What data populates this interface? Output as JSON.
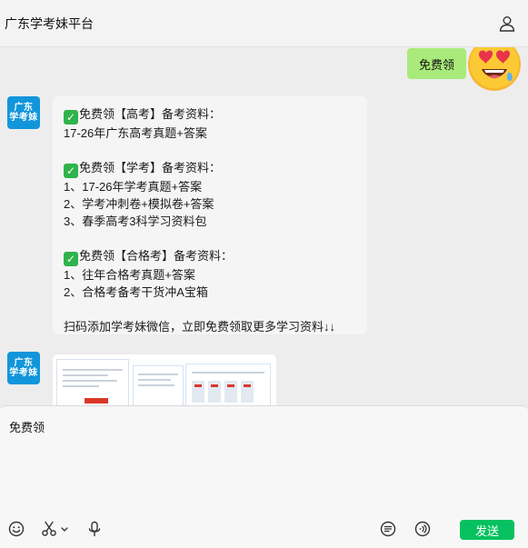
{
  "header": {
    "title": "广东学考妹平台"
  },
  "icons": {
    "profile": "user-icon",
    "emoji": "smiley-icon",
    "scissors": "scissors-icon",
    "mic": "microphone-icon",
    "list": "list-icon",
    "voice": "voice-icon"
  },
  "colors": {
    "send": "#07c160",
    "self_bubble": "#a9ea7a",
    "avatar": "#1296db",
    "check": "#2fb34a"
  },
  "messages": {
    "outgoing": {
      "text": "免费领"
    },
    "bot_avatar": {
      "line1": "广东",
      "line2": "学考妹"
    },
    "incoming_text": {
      "lines": [
        "免费领【高考】备考资料：",
        "17-26年广东高考真题+答案",
        "",
        "免费领【学考】备考资料：",
        "1、17-26年学考真题+答案",
        "2、学考冲刺卷+模拟卷+答案",
        "3、春季高考3科学习资料包",
        "",
        "免费领【合格考】备考资料：",
        "1、往年合格考真题+答案",
        "2、合格考备考干货冲A宝箱",
        "",
        "扫码添加学考妹微信，立即免费领取更多学习资料↓↓"
      ]
    }
  },
  "input": {
    "value": "免费领"
  },
  "send_button": {
    "label": "发送"
  }
}
